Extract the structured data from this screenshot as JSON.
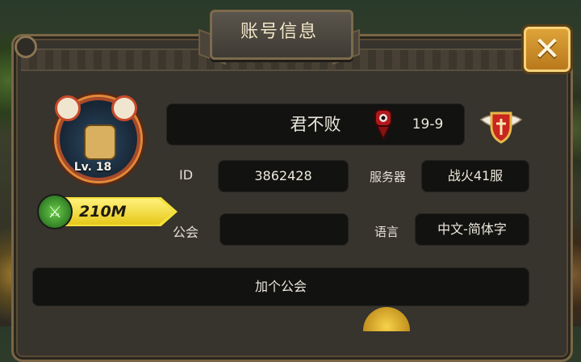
{
  "title": "账号信息",
  "close_icon": "close-x-icon",
  "player": {
    "name": "君不败",
    "level_label": "Lv. 18",
    "power": "210M",
    "rank": "19-9",
    "id_label": "ID",
    "id_value": "3862428",
    "server_label": "服务器",
    "server_value": "战火41服",
    "guild_label": "公会",
    "guild_value": "",
    "language_label": "语言",
    "language_value": "中文-简体字"
  },
  "join_guild_label": "加个公会",
  "colors": {
    "panel_bg": "#37332d",
    "field_bg": "#121210",
    "power_bar": "#f5e13a",
    "close_btn": "#e0a63a"
  }
}
